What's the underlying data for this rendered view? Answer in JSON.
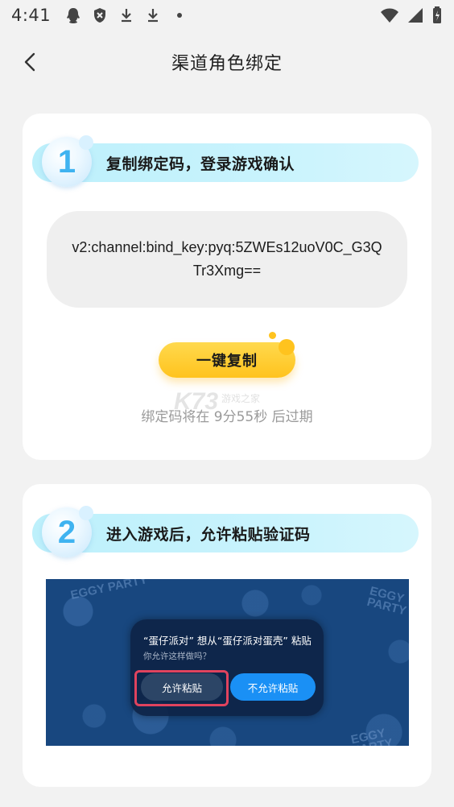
{
  "status_bar": {
    "time": "4:41",
    "icons": [
      "qq-icon",
      "shield-x-icon",
      "download-icon",
      "download-icon",
      "dot-icon"
    ],
    "right_icons": [
      "wifi-icon",
      "signal-icon",
      "battery-icon"
    ]
  },
  "header": {
    "title": "渠道角色绑定",
    "back_icon": "chevron-left-icon"
  },
  "step1": {
    "number": "1",
    "title": "复制绑定码，登录游戏确认",
    "bind_key": "v2:channel:bind_key:pyq:5ZWEs12uoV0C_G3QTr3Xmg==",
    "copy_button": "一键复制",
    "expire_text": "绑定码将在 9分55秒 后过期"
  },
  "watermark": {
    "logo": "K73",
    "text": "游戏之家"
  },
  "step2": {
    "number": "2",
    "title": "进入游戏后，允许粘贴验证码",
    "game_logo": "EGGY PARTY",
    "dialog": {
      "title": "“蛋仔派对” 想从“蛋仔派对蛋壳” 粘贴",
      "subtitle": "你允许这样做吗？",
      "allow_label": "允许粘贴",
      "deny_label": "不允许粘贴"
    }
  },
  "colors": {
    "background": "#f2f2f2",
    "card": "#ffffff",
    "step_pill": "#c8f3fd",
    "step_number": "#3fb3f0",
    "copy_button": "#ffc31e",
    "highlight": "#e0435e",
    "deny_button": "#1a90f5"
  }
}
